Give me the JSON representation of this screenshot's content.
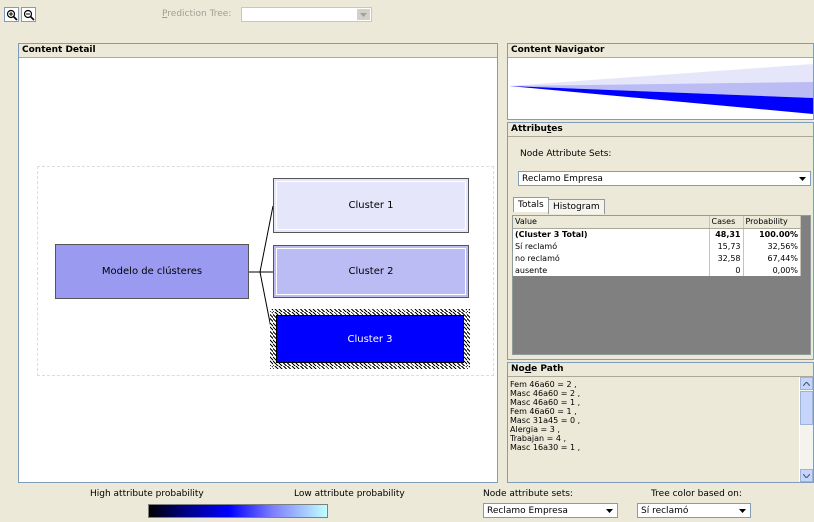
{
  "toolbar": {
    "zoom_in_icon": "zoom-in-icon",
    "zoom_out_icon": "zoom-out-icon",
    "prediction_tree_prefix": "P",
    "prediction_tree_rest": "rediction Tree:",
    "prediction_tree_value": ""
  },
  "content_detail": {
    "title": "Content Detail",
    "root_label": "Modelo de clústeres",
    "clusters": [
      {
        "label": "Cluster 1",
        "color": "#e6e6fb"
      },
      {
        "label": "Cluster 2",
        "color": "#bcbcf4"
      },
      {
        "label": "Cluster 3",
        "color": "#0000ff"
      }
    ],
    "root_color": "#9a9af0"
  },
  "content_navigator": {
    "title": "Content Navigator"
  },
  "attributes": {
    "title_a": "Attribu",
    "title_b": "t",
    "title_c": "es",
    "node_attr_sets_label": "Node Attribute Sets:",
    "selected_set": "Reclamo Empresa",
    "tabs": [
      "Totals",
      "Histogram"
    ],
    "columns": [
      "Value",
      "Cases",
      "Probability"
    ],
    "rows": [
      {
        "value": "(Cluster 3 Total)",
        "cases": "48,31",
        "prob": "100.00%",
        "bold": true
      },
      {
        "value": "Sí reclamó",
        "cases": "15,73",
        "prob": "32,56%"
      },
      {
        "value": "no reclamó",
        "cases": "32,58",
        "prob": "67,44%"
      },
      {
        "value": "ausente",
        "cases": "0",
        "prob": "0,00%"
      }
    ]
  },
  "node_path": {
    "title_a": "No",
    "title_b": "d",
    "title_c": "e Path",
    "lines": [
      "Fem 46a60 = 2 ,",
      "Masc 46a60 = 2 ,",
      "Masc 46a60 = 1 ,",
      "Fem 46a60 = 1 ,",
      "Masc 31a45 = 0 ,",
      "Alergia = 3 ,",
      "Trabajan = 4 ,",
      "Masc 16a30 = 1 ,"
    ]
  },
  "footer": {
    "high_label": "High attribute probability",
    "low_label": "Low attribute probability",
    "node_attr_sets_label": "Node attribute sets:",
    "node_attr_sets_value": "Reclamo Empresa",
    "tree_color_label": "Tree color based on:",
    "tree_color_value": "Sí reclamó"
  }
}
